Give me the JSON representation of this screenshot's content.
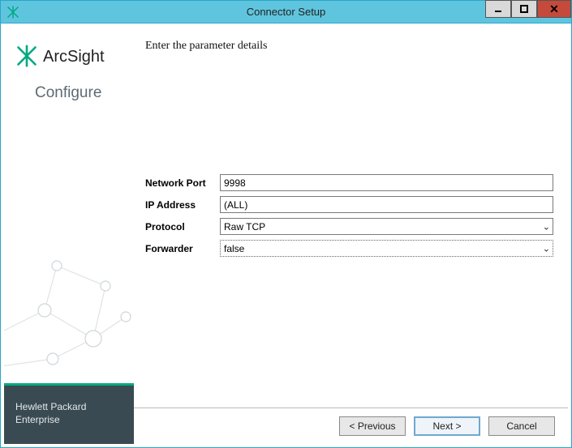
{
  "window": {
    "title": "Connector Setup"
  },
  "brand": {
    "product": "ArcSight",
    "section": "Configure",
    "company_line1": "Hewlett Packard",
    "company_line2": "Enterprise"
  },
  "main": {
    "heading": "Enter the parameter details",
    "fields": {
      "network_port": {
        "label": "Network Port",
        "value": "9998"
      },
      "ip_address": {
        "label": "IP Address",
        "value": "(ALL)"
      },
      "protocol": {
        "label": "Protocol",
        "value": "Raw TCP"
      },
      "forwarder": {
        "label": "Forwarder",
        "value": "false"
      }
    }
  },
  "buttons": {
    "previous": "< Previous",
    "next": "Next >",
    "cancel": "Cancel"
  }
}
